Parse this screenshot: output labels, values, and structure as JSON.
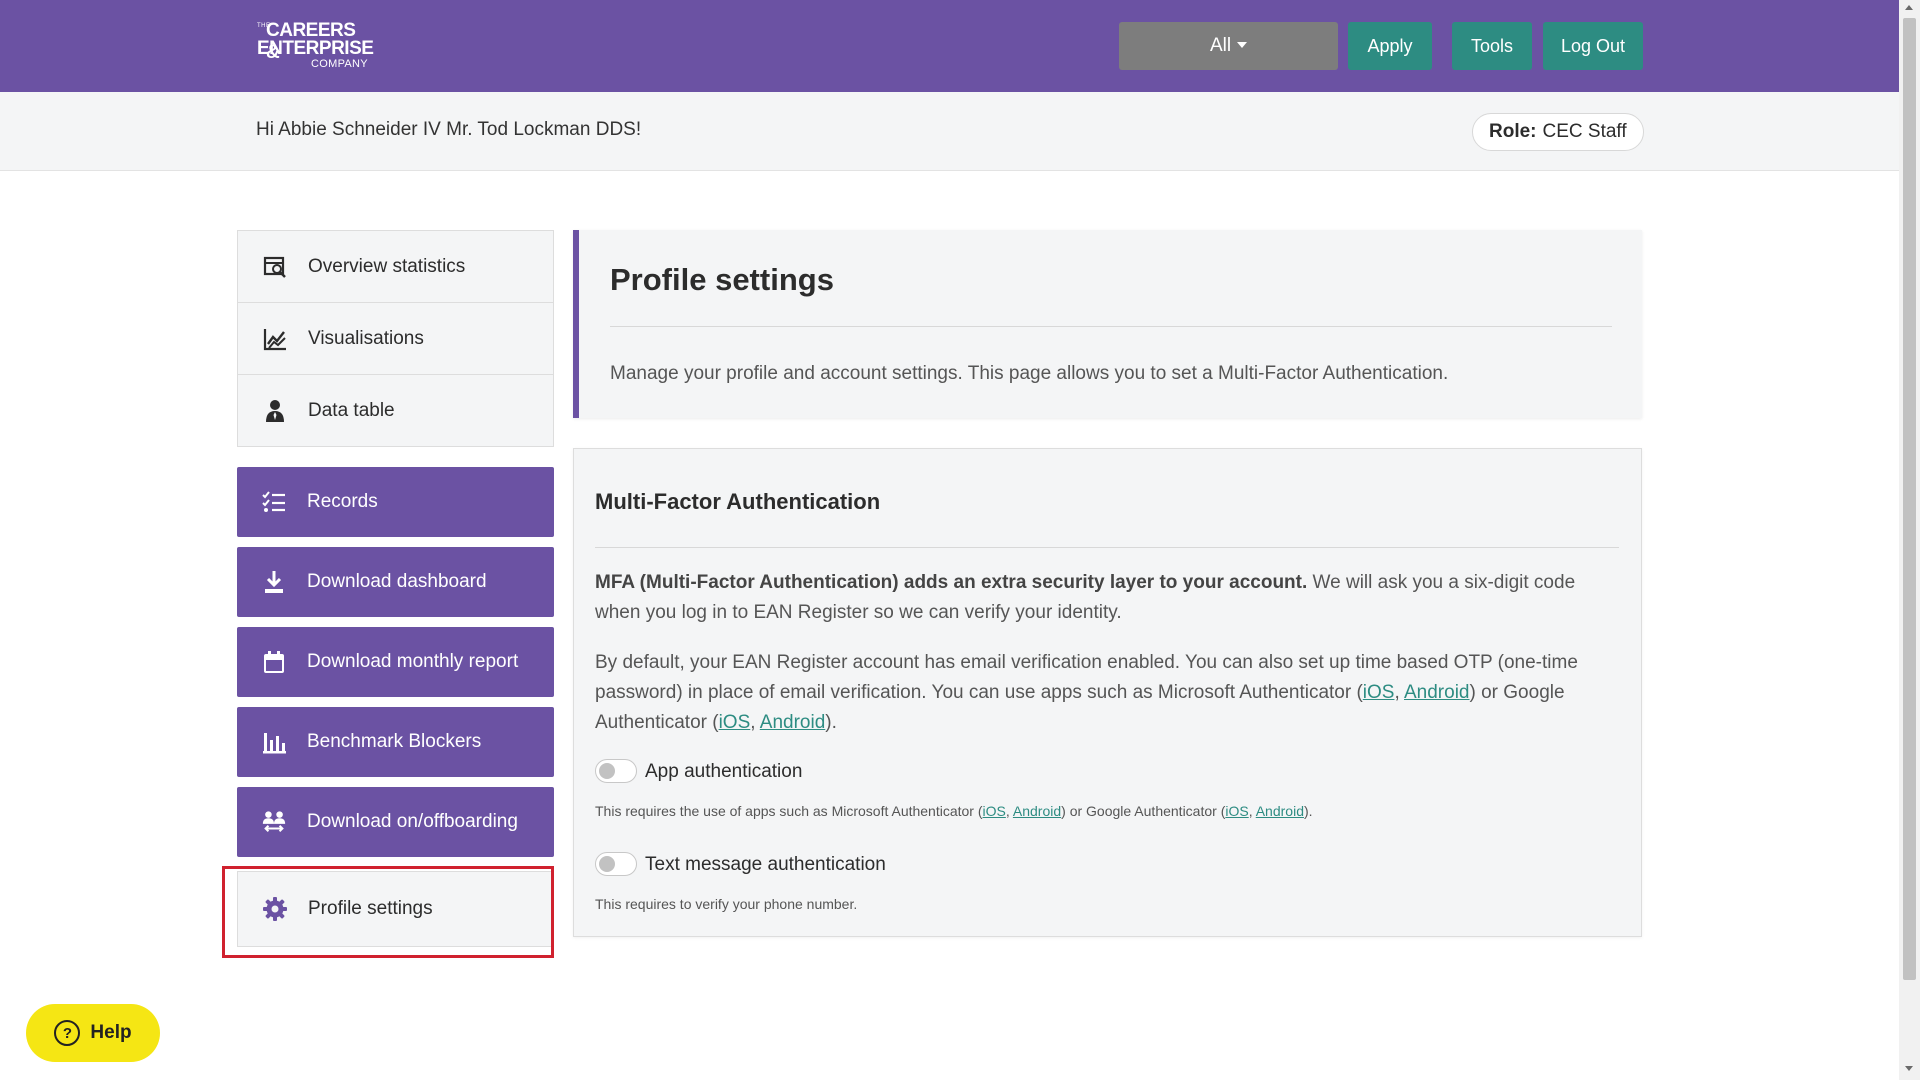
{
  "header": {
    "logo": {
      "small": "THE",
      "line1": "CAREERS &",
      "line2": "ENTERPRISE",
      "line3": "COMPANY"
    },
    "filter_label": "All",
    "apply_label": "Apply",
    "tools_label": "Tools",
    "logout_label": "Log Out"
  },
  "greeting": {
    "text": "Hi Abbie Schneider IV Mr. Tod Lockman DDS!",
    "role_label": "Role:",
    "role_value": "CEC Staff"
  },
  "sidebar": {
    "items": [
      {
        "label": "Overview statistics",
        "icon": "chart-search-icon"
      },
      {
        "label": "Visualisations",
        "icon": "chart-line-icon"
      },
      {
        "label": "Data table",
        "icon": "person-tie-icon"
      },
      {
        "label": "Records",
        "icon": "list-check-icon"
      },
      {
        "label": "Download dashboard",
        "icon": "download-icon"
      },
      {
        "label": "Download monthly report",
        "icon": "calendar-icon"
      },
      {
        "label": "Benchmark Blockers",
        "icon": "bar-chart-icon"
      },
      {
        "label": "Download on/offboarding",
        "icon": "people-arrows-icon"
      },
      {
        "label": "Profile settings",
        "icon": "gear-icon"
      }
    ]
  },
  "profile_panel": {
    "title": "Profile settings",
    "description": "Manage your profile and account settings. This page allows you to set a Multi-Factor Authentication."
  },
  "mfa_panel": {
    "title": "Multi-Factor Authentication",
    "intro_bold": "MFA (Multi-Factor Authentication) adds an extra security layer to your account.",
    "intro_rest_1": " We will ask you a six-digit code",
    "intro_rest_2": "when you log in to EAN Register so we can verify your identity.",
    "para2_line1": "By default, your EAN Register account has email verification enabled. You can also set up time based OTP (one-time",
    "para2_line2_pre": "password) in place of email verification. You can use apps such as Microsoft Authenticator (",
    "para2_line2_post": ") or Google",
    "para2_line3_pre": "Authenticator (",
    "para2_line3_post": ").",
    "link_ios": "iOS",
    "link_android": "Android",
    "sep": ", ",
    "app_auth_label": "App authentication",
    "app_auth_note_pre": "This requires the use of apps such as Microsoft Authenticator (",
    "app_auth_note_mid": ") or Google Authenticator (",
    "app_auth_note_post": ").",
    "sms_auth_label": "Text message authentication",
    "sms_auth_note": "This requires to verify your phone number."
  },
  "help": {
    "label": "Help",
    "glyph": "?"
  },
  "colors": {
    "brand_purple": "#6b52a3",
    "teal": "#2d8c82",
    "help_yellow": "#f5e614",
    "highlight_red": "#d0212e"
  }
}
